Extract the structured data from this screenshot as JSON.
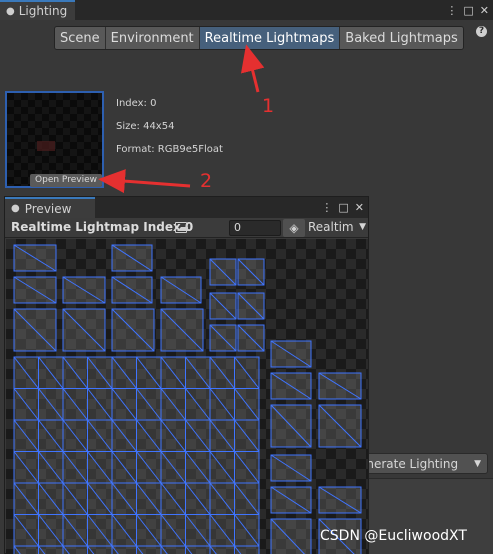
{
  "lighting_window": {
    "tab_label": "Lighting",
    "controls": [
      "⋮",
      "□",
      "✕"
    ],
    "help": "?",
    "modes": [
      {
        "label": "Scene",
        "active": false
      },
      {
        "label": "Environment",
        "active": false
      },
      {
        "label": "Realtime Lightmaps",
        "active": true
      },
      {
        "label": "Baked Lightmaps",
        "active": false
      }
    ],
    "lightmap_info": {
      "index": "Index: 0",
      "size": "Size: 44x54",
      "format": "Format: RGB9e5Float"
    },
    "open_preview_label": "Open Preview",
    "generate_label": "enerate Lighting"
  },
  "annotations": {
    "callout_1": "1",
    "callout_2": "2",
    "arrow_color": "#e53030"
  },
  "preview_window": {
    "tab_label": "Preview",
    "controls": [
      "⋮",
      "□",
      "✕"
    ],
    "title": "Realtime Lightmap Index 0",
    "index_value": "0",
    "mode_label": "Realtim",
    "chart_color": "#3f74ff"
  },
  "watermark": "CSDN @EucliwoodXT"
}
